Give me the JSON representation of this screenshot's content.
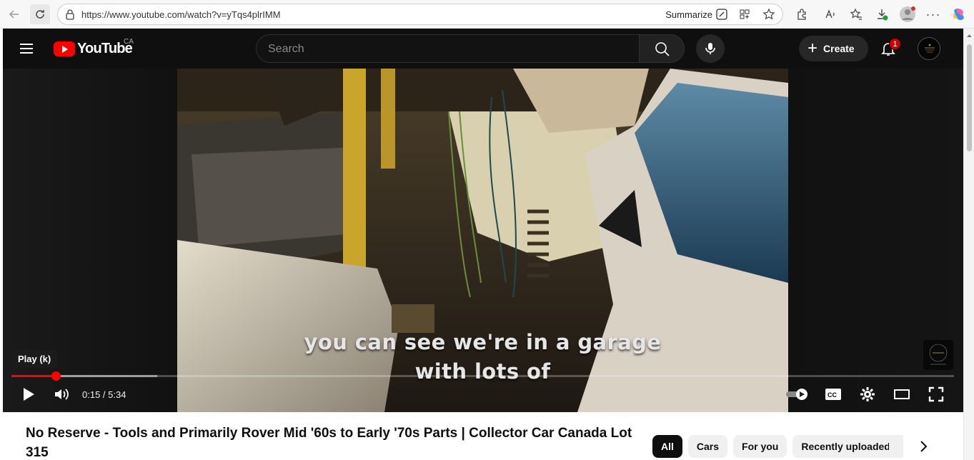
{
  "browser": {
    "url": "https://www.youtube.com/watch?v=yTqs4plrIMM",
    "summarize_label": "Summarize"
  },
  "youtube": {
    "logo_text": "YouTube",
    "country_code": "CA",
    "search_placeholder": "Search",
    "create_label": "Create",
    "notification_count": "1"
  },
  "player": {
    "tooltip": "Play (k)",
    "caption_lines": [
      "you can see we're in a garage",
      "with lots of"
    ],
    "current_time": "0:15",
    "duration": "5:34",
    "time_display": "0:15 / 5:34",
    "progress_fraction": 0.047,
    "buffer_fraction": 0.155
  },
  "video": {
    "title": "No Reserve - Tools and Primarily Rover Mid '60s to Early '70s Parts | Collector Car Canada Lot 315"
  },
  "chips": [
    "All",
    "Cars",
    "For you",
    "Recently uploaded"
  ],
  "colors": {
    "accent": "#ff0000",
    "header_bg": "#0f0f0f",
    "badge": "#cc0000"
  }
}
